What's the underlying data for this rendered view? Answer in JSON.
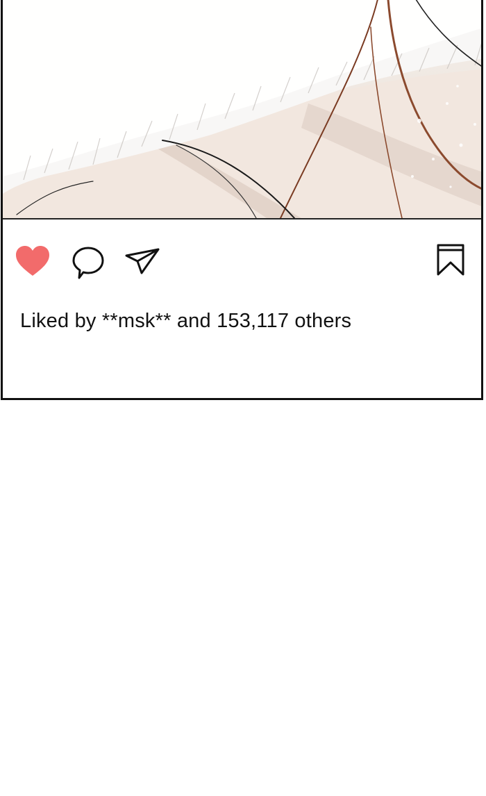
{
  "post": {
    "actions": {
      "like_icon": "heart-icon",
      "comment_icon": "speech-bubble-icon",
      "share_icon": "paper-plane-icon",
      "save_icon": "bookmark-icon",
      "like_color": "#f26b6b"
    },
    "likes_text": "Liked by **msk** and 153,117 others"
  }
}
